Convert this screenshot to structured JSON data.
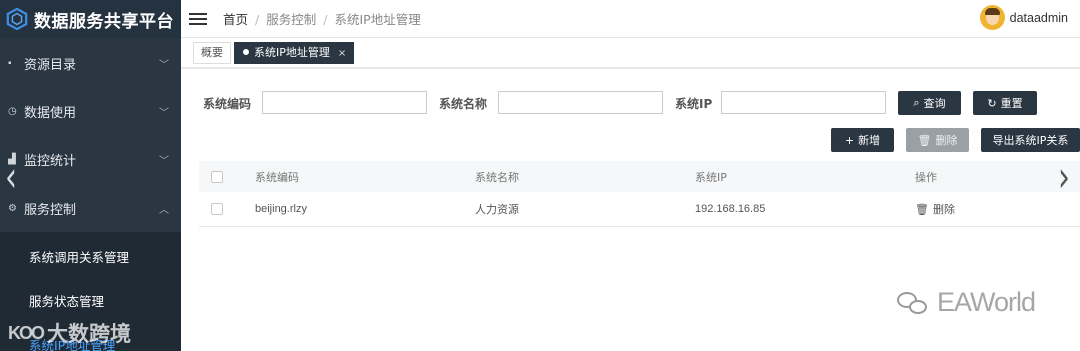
{
  "app": {
    "title": "数据服务共享平台"
  },
  "sidebar": {
    "items": [
      {
        "icon": "file-icon",
        "glyph": "▪",
        "label": "资源目录",
        "chevron": "﹀"
      },
      {
        "icon": "clock-icon",
        "glyph": "◷",
        "label": "数据使用",
        "chevron": "﹀"
      },
      {
        "icon": "chart-icon",
        "glyph": "▟",
        "label": "监控统计",
        "chevron": "﹀"
      },
      {
        "icon": "gears-icon",
        "glyph": "⚙",
        "label": "服务控制",
        "chevron": "︿"
      }
    ],
    "sub_items": [
      {
        "label": "系统调用关系管理"
      },
      {
        "label": "服务状态管理"
      },
      {
        "label": "系统IP地址管理"
      }
    ]
  },
  "header": {
    "breadcrumb": [
      "首页",
      "服务控制",
      "系统IP地址管理"
    ],
    "separator": "/",
    "user": "dataadmin"
  },
  "tabs": [
    {
      "label": "概要"
    },
    {
      "label": "系统IP地址管理",
      "close": "×"
    }
  ],
  "search": {
    "fields": [
      {
        "label": "系统编码",
        "value": ""
      },
      {
        "label": "系统名称",
        "value": ""
      },
      {
        "label": "系统IP",
        "value": ""
      }
    ],
    "query_label": "查询",
    "reset_label": "重置"
  },
  "actions": {
    "add_label": "新增",
    "delete_label": "删除",
    "export_label": "导出系统IP关系"
  },
  "table": {
    "columns": [
      "系统编码",
      "系统名称",
      "系统IP",
      "操作"
    ],
    "rows": [
      {
        "code": "beijing.rlzy",
        "name": "人力资源",
        "ip": "192.168.16.85",
        "action": "删除"
      }
    ]
  },
  "watermarks": {
    "right": "EAWorld",
    "left_logo": "KOO",
    "left_text": "大数跨境"
  },
  "colors": {
    "sidebar": "#2b3643",
    "accent": "#4aa3ff"
  }
}
